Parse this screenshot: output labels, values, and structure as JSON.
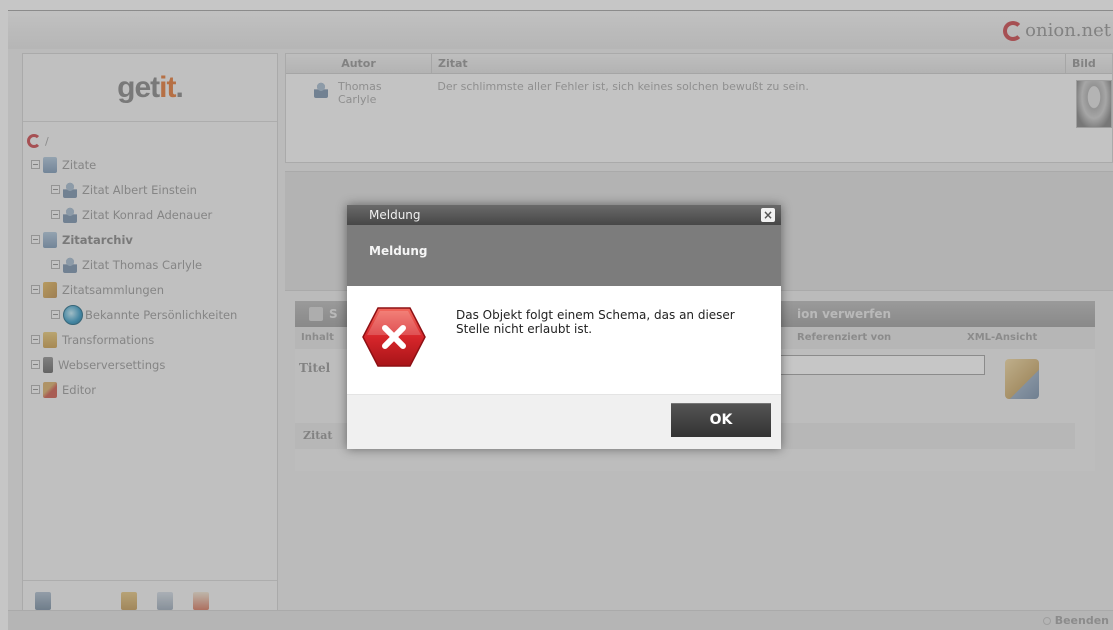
{
  "brand": {
    "name": "onion.net"
  },
  "sidebar": {
    "logo_main": "get",
    "logo_accent": "it",
    "logo_dot": ".",
    "root_label": "/",
    "tree": [
      {
        "label": "Zitate",
        "icon": "folder-icon",
        "bold": false,
        "indent": 0
      },
      {
        "label": "Zitat Albert Einstein",
        "icon": "user-icon",
        "bold": false,
        "indent": 1
      },
      {
        "label": "Zitat Konrad Adenauer",
        "icon": "user-icon",
        "bold": false,
        "indent": 1
      },
      {
        "label": "Zitatarchiv",
        "icon": "folder-icon",
        "bold": true,
        "indent": 0
      },
      {
        "label": "Zitat Thomas Carlyle",
        "icon": "user-icon",
        "bold": false,
        "indent": 1
      },
      {
        "label": "Zitatsammlungen",
        "icon": "collection-icon",
        "bold": false,
        "indent": 0
      },
      {
        "label": "Bekannte Persönlichkeiten",
        "icon": "globe-icon",
        "bold": false,
        "indent": 1
      },
      {
        "label": "Transformations",
        "icon": "transformations-icon",
        "bold": false,
        "indent": 0
      },
      {
        "label": "Webserversettings",
        "icon": "server-icon",
        "bold": false,
        "indent": 0
      },
      {
        "label": "Editor",
        "icon": "editor-icon",
        "bold": false,
        "indent": 0
      }
    ]
  },
  "table": {
    "headers": {
      "author": "Autor",
      "quote": "Zitat",
      "image": "Bild"
    },
    "rows": [
      {
        "author": "Thomas Carlyle",
        "quote": "Der schlimmste aller Fehler ist, sich keines solchen bewußt zu sein."
      }
    ]
  },
  "panel": {
    "toolbar_left": "S",
    "toolbar_right": "ion verwerfen",
    "tabs": {
      "content": "Inhalt",
      "referenced_by": "Referenziert von",
      "xml_view": "XML-Ansicht"
    },
    "title_label": "Titel",
    "quote_label": "Zitat"
  },
  "status": {
    "exit_label": "Beenden"
  },
  "dialog": {
    "window_title": "Meldung",
    "header": "Meldung",
    "message": "Das Objekt folgt einem Schema, das an dieser Stelle nicht erlaubt ist.",
    "ok_label": "OK",
    "close_glyph": "×",
    "error_color": "#d7262b"
  }
}
